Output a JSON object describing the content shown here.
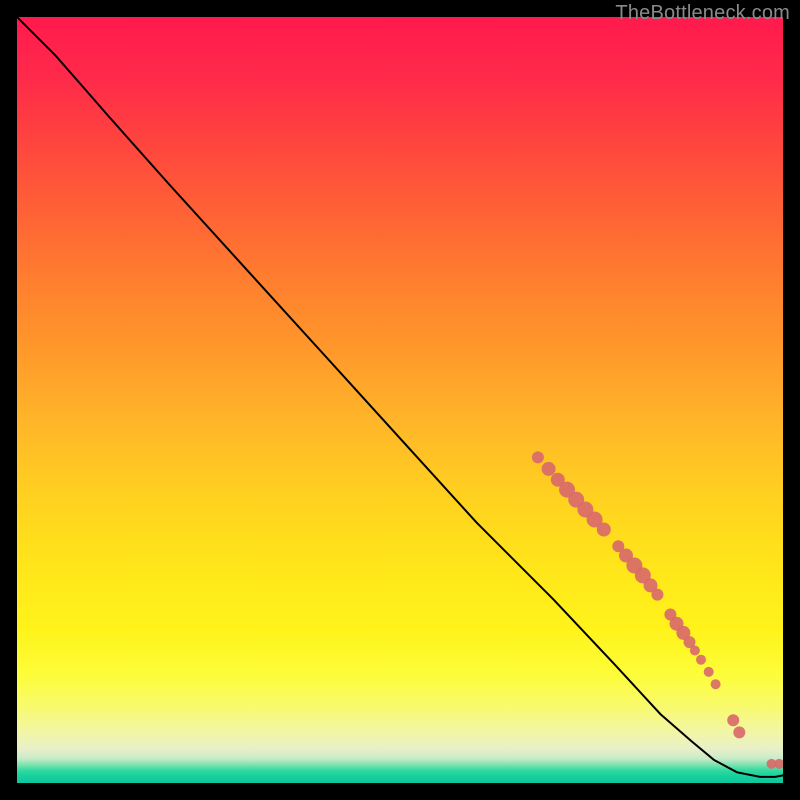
{
  "attribution": "TheBottleneck.com",
  "chart_data": {
    "type": "line",
    "title": "",
    "xlabel": "",
    "ylabel": "",
    "xlim": [
      0,
      100
    ],
    "ylim": [
      0,
      100
    ],
    "gradient_stops": [
      {
        "pos": 0,
        "color": "#ff1a4d"
      },
      {
        "pos": 25,
        "color": "#ff6036"
      },
      {
        "pos": 50,
        "color": "#ffb629"
      },
      {
        "pos": 75,
        "color": "#fff31a"
      },
      {
        "pos": 96,
        "color": "#e9f0c8"
      },
      {
        "pos": 100,
        "color": "#0cc79e"
      }
    ],
    "series": [
      {
        "name": "bottleneck-curve",
        "color": "#000000",
        "points": [
          {
            "x": 0.0,
            "y": 100.0
          },
          {
            "x": 2.0,
            "y": 98.0
          },
          {
            "x": 5.0,
            "y": 95.0
          },
          {
            "x": 8.5,
            "y": 91.0
          },
          {
            "x": 12.0,
            "y": 87.0
          },
          {
            "x": 20.0,
            "y": 78.0
          },
          {
            "x": 30.0,
            "y": 67.0
          },
          {
            "x": 40.0,
            "y": 56.0
          },
          {
            "x": 50.0,
            "y": 45.0
          },
          {
            "x": 60.0,
            "y": 34.0
          },
          {
            "x": 70.0,
            "y": 24.0
          },
          {
            "x": 78.0,
            "y": 15.5
          },
          {
            "x": 84.0,
            "y": 9.0
          },
          {
            "x": 88.0,
            "y": 5.5
          },
          {
            "x": 91.0,
            "y": 3.0
          },
          {
            "x": 94.0,
            "y": 1.4
          },
          {
            "x": 97.0,
            "y": 0.8
          },
          {
            "x": 99.0,
            "y": 0.8
          },
          {
            "x": 100.0,
            "y": 1.0
          }
        ]
      }
    ],
    "markers": {
      "name": "highlighted-points",
      "color": "#d96a6a",
      "radius_default": 7,
      "points": [
        {
          "x": 68.0,
          "y": 42.5,
          "r": 6
        },
        {
          "x": 69.4,
          "y": 41.0,
          "r": 7
        },
        {
          "x": 70.6,
          "y": 39.6,
          "r": 7
        },
        {
          "x": 71.8,
          "y": 38.3,
          "r": 8
        },
        {
          "x": 73.0,
          "y": 37.0,
          "r": 8
        },
        {
          "x": 74.2,
          "y": 35.7,
          "r": 8
        },
        {
          "x": 75.4,
          "y": 34.4,
          "r": 8
        },
        {
          "x": 76.6,
          "y": 33.1,
          "r": 7
        },
        {
          "x": 78.5,
          "y": 30.9,
          "r": 6
        },
        {
          "x": 79.5,
          "y": 29.7,
          "r": 7
        },
        {
          "x": 80.6,
          "y": 28.4,
          "r": 8
        },
        {
          "x": 81.7,
          "y": 27.1,
          "r": 8
        },
        {
          "x": 82.7,
          "y": 25.8,
          "r": 7
        },
        {
          "x": 83.6,
          "y": 24.6,
          "r": 6
        },
        {
          "x": 85.3,
          "y": 22.0,
          "r": 6
        },
        {
          "x": 86.1,
          "y": 20.8,
          "r": 7
        },
        {
          "x": 87.0,
          "y": 19.6,
          "r": 7
        },
        {
          "x": 87.8,
          "y": 18.4,
          "r": 6
        },
        {
          "x": 88.5,
          "y": 17.3,
          "r": 5
        },
        {
          "x": 89.3,
          "y": 16.1,
          "r": 5
        },
        {
          "x": 90.3,
          "y": 14.5,
          "r": 5
        },
        {
          "x": 91.2,
          "y": 12.9,
          "r": 5
        },
        {
          "x": 93.5,
          "y": 8.2,
          "r": 6
        },
        {
          "x": 94.3,
          "y": 6.6,
          "r": 6
        },
        {
          "x": 98.5,
          "y": 2.5,
          "r": 5
        },
        {
          "x": 99.5,
          "y": 2.5,
          "r": 5
        }
      ]
    }
  }
}
